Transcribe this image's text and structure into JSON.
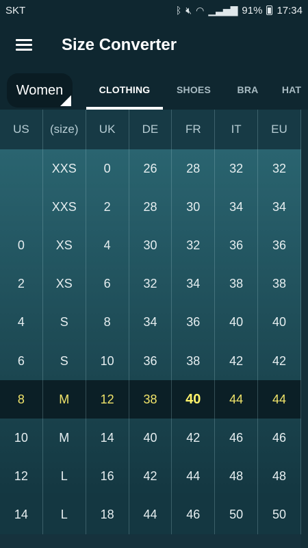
{
  "status": {
    "carrier": "SKT",
    "battery": "91%",
    "time": "17:34"
  },
  "appbar": {
    "title": "Size Converter"
  },
  "gender": {
    "selected": "Women"
  },
  "tabs": [
    {
      "label": "CLOTHING",
      "active": true
    },
    {
      "label": "SHOES",
      "active": false
    },
    {
      "label": "BRA",
      "active": false
    },
    {
      "label": "HAT",
      "active": false
    }
  ],
  "table": {
    "headers": [
      "US",
      "(size)",
      "UK",
      "DE",
      "FR",
      "IT",
      "EU"
    ],
    "rows": [
      [
        "",
        "XXS",
        "0",
        "26",
        "28",
        "32",
        "32"
      ],
      [
        "",
        "XXS",
        "2",
        "28",
        "30",
        "34",
        "34"
      ],
      [
        "0",
        "XS",
        "4",
        "30",
        "32",
        "36",
        "36"
      ],
      [
        "2",
        "XS",
        "6",
        "32",
        "34",
        "38",
        "38"
      ],
      [
        "4",
        "S",
        "8",
        "34",
        "36",
        "40",
        "40"
      ],
      [
        "6",
        "S",
        "10",
        "36",
        "38",
        "42",
        "42"
      ],
      [
        "8",
        "M",
        "12",
        "38",
        "40",
        "44",
        "44"
      ],
      [
        "10",
        "M",
        "14",
        "40",
        "42",
        "46",
        "46"
      ],
      [
        "12",
        "L",
        "16",
        "42",
        "44",
        "48",
        "48"
      ],
      [
        "14",
        "L",
        "18",
        "44",
        "46",
        "50",
        "50"
      ]
    ],
    "highlight_row": 6,
    "highlight_column": 4
  },
  "colors": {
    "highlight_text": "#f1e46a",
    "row_light": "#2a6470",
    "row_dark": "#143741"
  }
}
